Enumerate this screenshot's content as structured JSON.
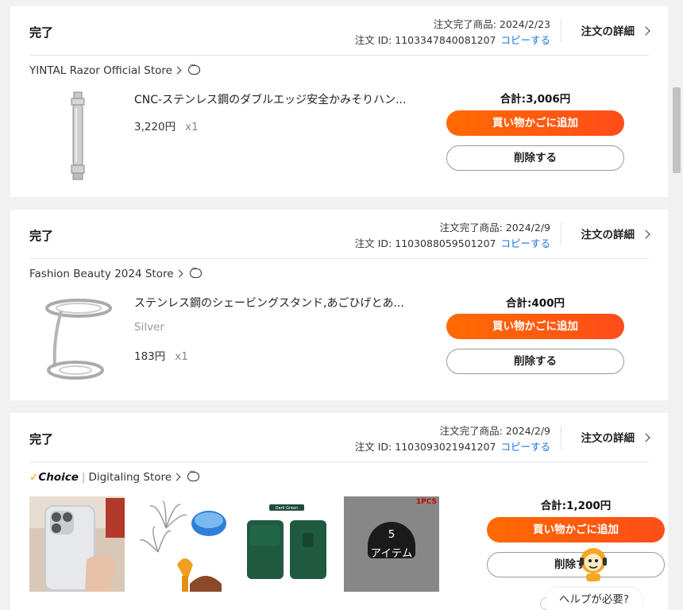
{
  "orders": [
    {
      "status": "完了",
      "completed_label": "注文完了商品: 2024/2/23",
      "order_id_label": "注文 ID: 1103347840081207",
      "copy_label": "コピーする",
      "detail_label": "注文の詳細",
      "store_name": "YINTAL Razor Official Store",
      "item": {
        "title": "CNC-ステンレス鋼のダブルエッジ安全かみそりハン...",
        "price": "3,220円",
        "qty": "x1",
        "image": "razor-image"
      },
      "total": "合計:3,006円",
      "add_cart_label": "買い物かごに追加",
      "delete_label": "削除する"
    },
    {
      "status": "完了",
      "completed_label": "注文完了商品: 2024/2/9",
      "order_id_label": "注文 ID: 1103088059501207",
      "copy_label": "コピーする",
      "detail_label": "注文の詳細",
      "store_name": "Fashion Beauty 2024 Store",
      "item": {
        "title": "ステンレス鋼のシェービングスタンド,あごひげとあ...",
        "variant": "Silver",
        "price": "183円",
        "qty": "x1",
        "image": "shaving-stand-image"
      },
      "total": "合計:400円",
      "add_cart_label": "買い物かごに追加",
      "delete_label": "削除する"
    },
    {
      "status": "完了",
      "completed_label": "注文完了商品: 2024/2/9",
      "order_id_label": "注文 ID: 1103093021941207",
      "copy_label": "コピーする",
      "detail_label": "注文の詳細",
      "choice_label": "Choice",
      "store_name": "Digitaling Store",
      "images": [
        "phone-case-image",
        "head-massager-image",
        "wallet-image"
      ],
      "more": {
        "count": "5",
        "label": "アイテム",
        "badge": "1PCS"
      },
      "wallet_tag": "Dark Green",
      "total": "合計:1,200円",
      "add_cart_label": "買い物かごに追加",
      "delete_label": "削除する"
    }
  ],
  "help": {
    "label": "ヘルプが必要?"
  },
  "colors": {
    "accent": "#ff5a0d",
    "link": "#1a73e8"
  }
}
